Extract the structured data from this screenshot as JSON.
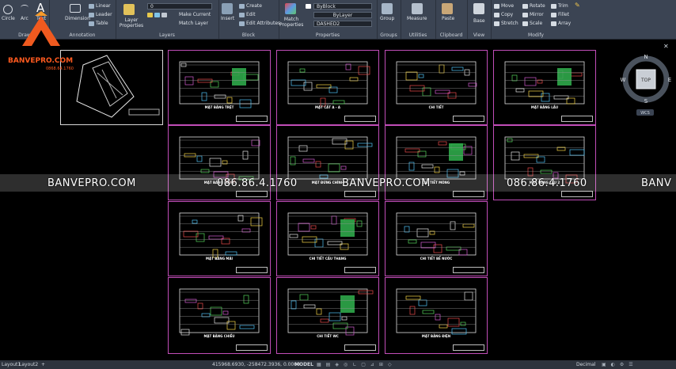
{
  "ribbon": {
    "draw": {
      "circle": "Circle",
      "arc": "Arc",
      "text": "Text",
      "dimension": "Dimension",
      "title": "Draw"
    },
    "annotation": {
      "linear": "Linear",
      "leader": "Leader",
      "table": "Table",
      "title": "Annotation"
    },
    "layers": {
      "layer_properties": "Layer Properties",
      "layer_value": "0",
      "make_current": "Make Current",
      "match_layer": "Match Layer",
      "title": "Layers"
    },
    "block": {
      "insert": "Insert",
      "create": "Create",
      "edit": "Edit",
      "edit_attributes": "Edit Attributes",
      "title": "Block"
    },
    "properties": {
      "match": "Match Properties",
      "color": "ByBlock",
      "linetype": "ByLayer",
      "lineweight": "DASHED2",
      "title": "Properties"
    },
    "groups": {
      "group": "Group",
      "title": "Groups"
    },
    "utilities": {
      "measure": "Measure",
      "title": "Utilities"
    },
    "clipboard": {
      "paste": "Paste",
      "title": "Clipboard"
    },
    "view": {
      "base": "Base",
      "title": "View"
    },
    "modify": {
      "move": "Move",
      "rotate": "Rotate",
      "trim": "Trim",
      "copy": "Copy",
      "mirror": "Mirror",
      "fillet": "Fillet",
      "stretch": "Stretch",
      "scale": "Scale",
      "array": "Array",
      "title": "Modify"
    }
  },
  "viewcube": {
    "n": "N",
    "s": "S",
    "e": "E",
    "w": "W",
    "top": "TOP",
    "wcs": "WCS"
  },
  "logo": {
    "brand": "BANVEPRO.COM",
    "phone": "0868.64.1760"
  },
  "watermark": {
    "site": "BANVEPRO.COM",
    "phone": "086.86.4.1760"
  },
  "status": {
    "coords": "415968.6930, -258472.3936, 0.0000",
    "model": "MODEL",
    "layout1": "Layout1",
    "layout2": "Layout2",
    "units": "Decimal"
  },
  "sheets": [
    {
      "cap": "MẶT BẰNG TRỆT"
    },
    {
      "cap": "MẶT CẮT A - A"
    },
    {
      "cap": "CHI TIẾT"
    },
    {
      "cap": "MẶT BẰNG LẦU"
    },
    {
      "cap": "MẶT BẰNG LẦU 1"
    },
    {
      "cap": "MẶT ĐỨNG CHÍNH"
    },
    {
      "cap": "CHI TIẾT MÓNG"
    },
    {
      "cap": "MẶT BẰNG LẦU 2"
    },
    {
      "cap": "MẶT BẰNG MÁI"
    },
    {
      "cap": "CHI TIẾT CẦU THANG"
    },
    {
      "cap": "CHI TIẾT BỂ NƯỚC"
    },
    {
      "cap": "MẶT BẰNG CHIẾU"
    },
    {
      "cap": "CHI TIẾT WC"
    },
    {
      "cap": "MẶT BẰNG ĐIỆN"
    }
  ]
}
